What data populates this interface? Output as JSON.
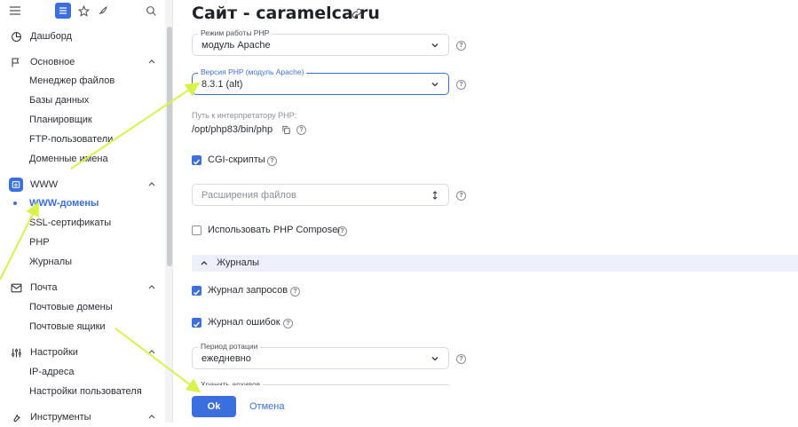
{
  "sidebar": {
    "top_icons": [
      "menu-icon",
      "list-icon",
      "star-icon",
      "feather-icon",
      "search-icon"
    ],
    "dashboard": "Дашборд",
    "sections": [
      {
        "label": "Основное",
        "items": [
          "Менеджер файлов",
          "Базы данных",
          "Планировщик",
          "FTP-пользователи",
          "Доменные имена"
        ]
      },
      {
        "label": "WWW",
        "items": [
          "WWW-домены",
          "SSL-сертификаты",
          "PHP",
          "Журналы"
        ]
      },
      {
        "label": "Почта",
        "items": [
          "Почтовые домены",
          "Почтовые ящики"
        ]
      },
      {
        "label": "Настройки",
        "items": [
          "IP-адреса",
          "Настройки пользователя"
        ]
      },
      {
        "label": "Инструменты",
        "items": []
      }
    ],
    "active_item": "WWW-домены"
  },
  "main": {
    "title": "Сайт - caramelca.ru",
    "php_mode": {
      "label": "Режим работы PHP",
      "value": "модуль Apache"
    },
    "php_version": {
      "label": "Версия PHP (модуль Apache)",
      "value": "8.3.1 (alt)"
    },
    "interpreter": {
      "label": "Путь к интерпретатору PHP:",
      "value": "/opt/php83/bin/php"
    },
    "cgi": {
      "label": "CGI-скрипты",
      "checked": true
    },
    "extensions": {
      "placeholder": "Расширения файлов"
    },
    "composer": {
      "label": "Использовать PHP Composer",
      "checked": false
    },
    "logs_section": "Журналы",
    "access_log": {
      "label": "Журнал запросов",
      "checked": true
    },
    "error_log": {
      "label": "Журнал ошибок",
      "checked": true
    },
    "rotation": {
      "label": "Период ротации",
      "value": "ежедневно"
    },
    "archives": {
      "label": "Хранить архивов"
    },
    "ok": "Ok",
    "cancel": "Отмена"
  },
  "colors": {
    "accent": "#3b6fe0",
    "annotation": "#d9f24a",
    "section_bg": "#edf0fb"
  }
}
